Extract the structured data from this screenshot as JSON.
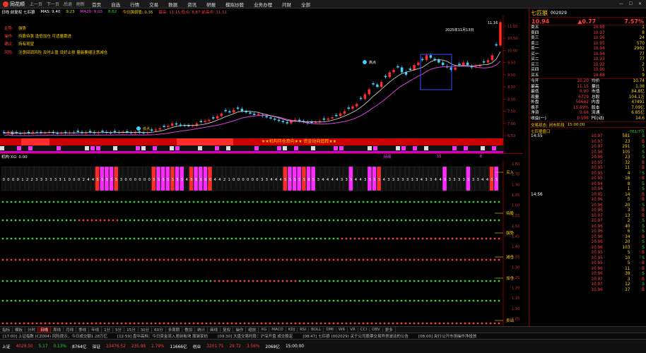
{
  "menubar": {
    "app_name": "同花顺",
    "nav_buttons": [
      "上一页",
      "下一页",
      "后退",
      "刷新"
    ],
    "menus": [
      "首页",
      "自选",
      "行情",
      "交易",
      "数据",
      "资讯",
      "研报",
      "模拟炒股",
      "业务办理",
      "问财",
      "全部"
    ]
  },
  "infobar": {
    "label": "日线 前复权 七匹狼",
    "ma5": "MA5: 9.40",
    "ma10": "9.23",
    "ma20": "MA20: 9.03",
    "ma60": "8.62",
    "extra": "今日强弱值: 0.35",
    "hint": "最高: 11.15 低点: 8.87  前高点: 11.11"
  },
  "chart_text": {
    "date_label": "2025年11月13日",
    "price_top": "11.16",
    "price_low": "6.56",
    "high_tag": "高点",
    "low_tag": "低点",
    "banner": "★★机构持仓意向★★ 资金动向追踪★★",
    "annot_lines": [
      {
        "label": "走势:",
        "text": "强势"
      },
      {
        "label": "操作:",
        "text": "持股待涨 逢低加仓 可适量跟进"
      },
      {
        "label": "建议:",
        "text": "持有观望"
      },
      {
        "label": "风险:",
        "text": "注意回调风险 及时止盈 设好止损 量能萎缩注意减仓"
      }
    ],
    "ind_title": "机构 XG: 0.00",
    "ind_mid_labels": [
      "持续",
      "35",
      "8"
    ],
    "ind_right_labels": [
      "买入",
      "持股",
      "强势",
      "减仓",
      "加仓",
      "卖出"
    ]
  },
  "y_axis": {
    "main": [
      "11.00",
      "10.50",
      "10.00",
      "9.50",
      "9.00",
      "8.50",
      "8.00",
      "7.50",
      "7.00",
      "6.50"
    ],
    "ind": [
      "1.80",
      "1.75",
      "1.70",
      "1.65",
      "1.60",
      "1.55",
      "1.50",
      "1.45",
      "1.40",
      "1.35",
      "1.30",
      "1.25",
      "1.20",
      "1.15",
      "1.10",
      "1.05",
      "1.00"
    ]
  },
  "chart_data": {
    "type": "candlestick",
    "closes": [
      6.6,
      6.65,
      6.55,
      6.6,
      6.58,
      6.62,
      6.6,
      6.64,
      6.63,
      6.6,
      6.62,
      6.65,
      6.6,
      6.58,
      6.62,
      6.6,
      6.63,
      6.62,
      6.65,
      6.6,
      6.62,
      6.64,
      6.6,
      6.63,
      6.65,
      6.62,
      6.6,
      6.64,
      6.62,
      6.66,
      6.63,
      6.6,
      6.65,
      6.62,
      6.6,
      6.63,
      6.7,
      6.75,
      6.8,
      6.85,
      6.9,
      7.0,
      6.95,
      6.92,
      6.9,
      6.88,
      6.9,
      7.0,
      7.05,
      7.1,
      7.15,
      7.2,
      7.3,
      7.4,
      7.5,
      7.45,
      7.55,
      7.6,
      7.5,
      7.45,
      7.4,
      7.35,
      7.4,
      7.3,
      7.25,
      7.2,
      7.15,
      7.1,
      7.05,
      7.0,
      7.1,
      7.15,
      7.1,
      7.05,
      7.0,
      7.02,
      7.05,
      7.1,
      7.15,
      7.2,
      7.25,
      7.3,
      7.4,
      7.5,
      7.6,
      7.7,
      7.8,
      8.0,
      8.2,
      8.4,
      8.6,
      8.5,
      8.7,
      8.9,
      9.1,
      9.2,
      9.3,
      9.1,
      9.0,
      9.2,
      9.4,
      9.5,
      9.6,
      9.8,
      9.7,
      9.6,
      9.5,
      9.4,
      9.3,
      9.2,
      9.3,
      9.4,
      9.5,
      9.4,
      9.3,
      9.35,
      9.4,
      9.5,
      9.6,
      9.8,
      10.2,
      11.16
    ],
    "ma_window": 12,
    "ylim": [
      6.5,
      11.2
    ]
  },
  "ind_rows": [
    [
      "0",
      "0",
      "0",
      "0",
      "1",
      "2",
      "2",
      "3",
      "3",
      "3",
      "3",
      "3",
      "3",
      "1",
      "0",
      "0",
      "0",
      "2",
      "4",
      "4",
      "5",
      "5",
      "5",
      "5",
      "5",
      "3",
      "0",
      "0",
      "0",
      "0",
      "0",
      "0",
      "5",
      "5",
      "5",
      "5",
      "5",
      "5",
      "5",
      "4",
      "5",
      "6",
      "6",
      "6",
      "6",
      "4",
      "4",
      "2",
      "1",
      "0",
      "0",
      "0",
      "0",
      "0",
      "0",
      "3",
      "3",
      "4",
      "4",
      "4",
      "5",
      "5",
      "5",
      "5",
      "5",
      "6",
      "5",
      "3",
      "4",
      "4",
      "4",
      "4",
      "3",
      "3",
      "5",
      "4",
      "4",
      "3",
      "5",
      "5",
      "5",
      "4",
      "3",
      "3",
      "3",
      "3",
      "3",
      "3",
      "3",
      "4",
      "3",
      "3",
      "4",
      "4",
      "5",
      "3",
      "3",
      "3",
      "3",
      "5",
      "3",
      "3",
      "4",
      "4",
      "5",
      "5"
    ]
  ],
  "side": {
    "stock_name": "七匹狼",
    "stock_code": "002029",
    "price": "10.94",
    "change": "▲0.77",
    "pct": "7.57%",
    "sell": [
      {
        "k": "卖五",
        "p": "10.98",
        "v": "1"
      },
      {
        "k": "卖四",
        "p": "10.97",
        "v": "8"
      },
      {
        "k": "卖三",
        "p": "10.96",
        "v": "24"
      },
      {
        "k": "卖二",
        "p": "10.95",
        "v": "570"
      },
      {
        "k": "卖一",
        "p": "10.94",
        "v": "2902"
      }
    ],
    "buy": [
      {
        "k": "买一",
        "p": "10.94",
        "v": "77"
      },
      {
        "k": "买二",
        "p": "10.93",
        "v": "77"
      },
      {
        "k": "买三",
        "p": "10.92",
        "v": "2"
      },
      {
        "k": "买四",
        "p": "10.90",
        "v": "1"
      },
      {
        "k": "买五",
        "p": "10.88",
        "v": "9"
      }
    ],
    "stats": [
      [
        "今开",
        "10.20",
        "均价",
        "10.74"
      ],
      [
        "最高",
        "11.15",
        "量比",
        "1.38"
      ],
      [
        "最低",
        "9.90",
        "市值",
        "84.8亿"
      ],
      [
        "现量",
        "6729",
        "总股",
        "104.1万"
      ],
      [
        "外盘",
        "56642",
        "内盘",
        "47491"
      ],
      [
        "换手",
        "15.89%",
        "股本",
        "7.09亿"
      ],
      [
        "净资",
        "9.68",
        "流通",
        "6.85亿"
      ],
      [
        "收益(一)",
        "0.598",
        "PE(动)",
        "14.6"
      ]
    ],
    "status_label": "交易状态: 闭市阶段",
    "status_time": "15:00:00",
    "ticks_header": "七匹狼盘口",
    "ticks_change": "-761/7万",
    "ticks": [
      [
        "14:55",
        "10.97",
        "581",
        "S"
      ],
      [
        "",
        "10.97",
        "23",
        "B"
      ],
      [
        "",
        "10.97",
        "291",
        "S"
      ],
      [
        "",
        "10.96",
        "105",
        "S"
      ],
      [
        "",
        "10.96",
        "23",
        "S"
      ],
      [
        "",
        "10.95",
        "32",
        "B"
      ],
      [
        "",
        "10.95",
        "11",
        "B"
      ],
      [
        "",
        "10.95",
        "4",
        "S"
      ],
      [
        "",
        "10.95",
        "16",
        "B"
      ],
      [
        "",
        "10.94",
        "8",
        "S"
      ],
      [
        "",
        "10.94",
        "1",
        "S"
      ],
      [
        "14:56",
        "10.95",
        "14",
        "B"
      ],
      [
        "",
        "10.96",
        "5",
        "B"
      ],
      [
        "",
        "10.96",
        "20",
        "S"
      ],
      [
        "",
        "10.96",
        "3",
        "B"
      ],
      [
        "",
        "10.97",
        "13",
        "B"
      ],
      [
        "",
        "10.97",
        "2",
        "S"
      ],
      [
        "",
        "10.96",
        "40",
        "S"
      ],
      [
        "",
        "10.96",
        "6",
        "S"
      ],
      [
        "",
        "10.96",
        "34",
        "B"
      ],
      [
        "",
        "10.96",
        "20",
        "S"
      ],
      [
        "",
        "10.96",
        "103",
        "S"
      ],
      [
        "",
        "10.95",
        "5",
        "B"
      ],
      [
        "",
        "10.95",
        "10",
        "S"
      ],
      [
        "",
        "10.95",
        "5",
        "B"
      ],
      [
        "",
        "10.96",
        "11",
        "B"
      ],
      [
        "",
        "10.96",
        "38",
        "S"
      ],
      [
        "",
        "10.97",
        "3",
        "B"
      ],
      [
        "",
        "10.97",
        "12",
        "S"
      ],
      [
        "",
        "10.96",
        "37",
        "B"
      ],
      [
        "",
        "10.95",
        "8",
        "S"
      ],
      [
        "",
        "10.95",
        "88",
        "S"
      ],
      [
        "",
        "10.94",
        "60",
        "S"
      ],
      [
        "",
        "10.95",
        "47",
        "B"
      ],
      [
        "",
        "10.96",
        "7",
        "S"
      ],
      [
        "14:57",
        "10.95",
        "30",
        "S"
      ],
      [
        "15:00",
        "10.94",
        "6729",
        "B"
      ]
    ]
  },
  "bottom_tabs": [
    "指标",
    "模板",
    "分时",
    "日线",
    "周线",
    "月线",
    "季线",
    "年线",
    "1分",
    "5分",
    "15分",
    "30分",
    "60分",
    "多周期",
    "叠加",
    "统计",
    "画线",
    "复权",
    "操作",
    "缩放",
    "XG",
    "MACD",
    "KDJ",
    "RSI",
    "BOLL",
    "DMI",
    "WR",
    "VR",
    "CCI",
    "OBV",
    "更多"
  ],
  "news": [
    "[17:00] 上证指数 (CZ004) 风险提示，今日成交额1.28万亿",
    "[12:59] 盘中高档：今日资金流入居前板块 服装家纺",
    "[09:30] 大盘交易时段：沪深开盘 成交稳定",
    "[08:47] 七匹狼 (002029) 关于公司股票交易异常波动的公告",
    "[08:00] 央行公开市场操作净投放"
  ],
  "footer": [
    {
      "k": "上证",
      "v": "4029.50",
      "c": "red"
    },
    {
      "k": "",
      "v": "5.17",
      "c": "green"
    },
    {
      "k": "",
      "v": "0.13%",
      "c": "green"
    },
    {
      "k": "",
      "v": "8764亿",
      "c": "wht"
    },
    {
      "k": "深证",
      "v": "13476.52",
      "c": "red"
    },
    {
      "k": "",
      "v": "235.98",
      "c": "red"
    },
    {
      "k": "",
      "v": "1.79%",
      "c": "red"
    },
    {
      "k": "",
      "v": "11666亿",
      "c": "wht"
    },
    {
      "k": "创业",
      "v": "3201.75",
      "c": "red"
    },
    {
      "k": "",
      "v": "29.72",
      "c": "red"
    },
    {
      "k": "",
      "v": "3.56%",
      "c": "red"
    },
    {
      "k": "",
      "v": "2068亿",
      "c": "wht"
    },
    {
      "k": "",
      "v": "15:00:00",
      "c": "wht"
    }
  ]
}
